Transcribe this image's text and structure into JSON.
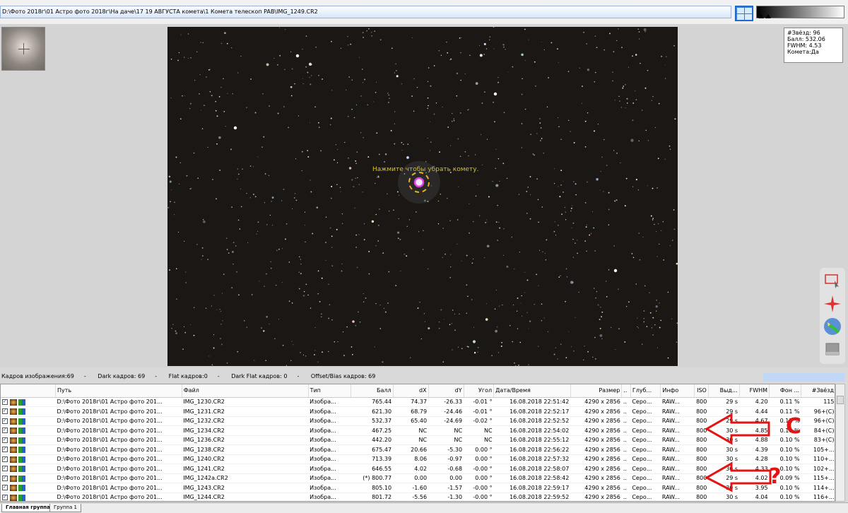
{
  "path": "D:\\Фото 2018г\\01 Астро фото 2018г\\На даче\\17  19 АВГУСТА комета\\1 Комета телескоп PAB\\IMG_1249.CR2",
  "stats": {
    "stars": "#Звёзд: 96",
    "score": "Балл: 532.06",
    "fwhm": "FWHM: 4.53",
    "comet": "Комета:Да"
  },
  "comet_hint": "Нажмите чтобы убрать комету.",
  "counts": {
    "light": "Кадров изображения:69",
    "dark": "Dark кадров: 69",
    "flat": "Flat кадров:0",
    "darkflat": "Dark Flat кадров: 0",
    "bias": "Offset/Bias кадров: 69"
  },
  "columns": [
    "",
    "Путь",
    "Файл",
    "Тип",
    "Балл",
    "dX",
    "dY",
    "Угол",
    "Дата/Время",
    "Размер",
    "..",
    "Глуб...",
    "Инфо",
    "ISO",
    "Выд...",
    "FWHM",
    "Фон ...",
    "#Звёзд"
  ],
  "rows": [
    [
      "D:\\Фото 2018г\\01 Астро фото 201...",
      "IMG_1230.CR2",
      "Изобра...",
      "765.44",
      "74.37",
      "-26.33",
      "-0.01 °",
      "16.08.2018 22:51:42",
      "4290 x 2856",
      "..",
      "Серо...",
      "RAW...",
      "800",
      "29 s",
      "4.20",
      "0.11 %",
      "115"
    ],
    [
      "D:\\Фото 2018г\\01 Астро фото 201...",
      "IMG_1231.CR2",
      "Изобра...",
      "621.30",
      "68.79",
      "-24.46",
      "-0.01 °",
      "16.08.2018 22:52:17",
      "4290 x 2856",
      "..",
      "Серо...",
      "RAW...",
      "800",
      "29 s",
      "4.44",
      "0.11 %",
      "96+(C)"
    ],
    [
      "D:\\Фото 2018г\\01 Астро фото 201...",
      "IMG_1232.CR2",
      "Изобра...",
      "532.37",
      "65.40",
      "-24.69",
      "-0.02 °",
      "16.08.2018 22:52:52",
      "4290 x 2856",
      "..",
      "Серо...",
      "RAW...",
      "800",
      "29 s",
      "4.67",
      "0.11 %",
      "96+(C)"
    ],
    [
      "D:\\Фото 2018г\\01 Астро фото 201...",
      "IMG_1234.CR2",
      "Изобра...",
      "467.25",
      "NC",
      "NC",
      "NC",
      "16.08.2018 22:54:02",
      "4290 x 2856",
      "..",
      "Серо...",
      "RAW...",
      "800",
      "30 s",
      "4.85",
      "0.10 %",
      "84+(C)"
    ],
    [
      "D:\\Фото 2018г\\01 Астро фото 201...",
      "IMG_1236.CR2",
      "Изобра...",
      "442.20",
      "NC",
      "NC",
      "NC",
      "16.08.2018 22:55:12",
      "4290 x 2856",
      "..",
      "Серо...",
      "RAW...",
      "800",
      "30 s",
      "4.88",
      "0.10 %",
      "83+(C)"
    ],
    [
      "D:\\Фото 2018г\\01 Астро фото 201...",
      "IMG_1238.CR2",
      "Изобра...",
      "675.47",
      "20.66",
      "-5.30",
      "0.00 °",
      "16.08.2018 22:56:22",
      "4290 x 2856",
      "..",
      "Серо...",
      "RAW...",
      "800",
      "30 s",
      "4.39",
      "0.10 %",
      "105+..."
    ],
    [
      "D:\\Фото 2018г\\01 Астро фото 201...",
      "IMG_1240.CR2",
      "Изобра...",
      "713.39",
      "8.06",
      "-0.97",
      "0.00 °",
      "16.08.2018 22:57:32",
      "4290 x 2856",
      "..",
      "Серо...",
      "RAW...",
      "800",
      "30 s",
      "4.28",
      "0.10 %",
      "110+..."
    ],
    [
      "D:\\Фото 2018г\\01 Астро фото 201...",
      "IMG_1241.CR2",
      "Изобра...",
      "646.55",
      "4.02",
      "-0.68",
      "-0.00 °",
      "16.08.2018 22:58:07",
      "4290 x 2856",
      "..",
      "Серо...",
      "RAW...",
      "800",
      "30 s",
      "4.33",
      "0.10 %",
      "102+..."
    ],
    [
      "D:\\Фото 2018г\\01 Астро фото 201...",
      "IMG_1242a.CR2",
      "Изобра...",
      "(*) 800.77",
      "0.00",
      "0.00",
      "0.00 °",
      "16.08.2018 22:58:42",
      "4290 x 2856",
      "..",
      "Серо...",
      "RAW...",
      "800",
      "29 s",
      "4.02",
      "0.09 %",
      "115+..."
    ],
    [
      "D:\\Фото 2018г\\01 Астро фото 201...",
      "IMG_1243.CR2",
      "Изобра...",
      "805.10",
      "-1.60",
      "-1.57",
      "-0.00 °",
      "16.08.2018 22:59:17",
      "4290 x 2856",
      "..",
      "Серо...",
      "RAW...",
      "800",
      "30 s",
      "3.95",
      "0.10 %",
      "114+..."
    ],
    [
      "D:\\Фото 2018г\\01 Астро фото 201...",
      "IMG_1244.CR2",
      "Изобра...",
      "801.72",
      "-5.56",
      "-1.30",
      "-0.00 °",
      "16.08.2018 22:59:52",
      "4290 x 2856",
      "..",
      "Серо...",
      "RAW...",
      "800",
      "30 s",
      "4.04",
      "0.10 %",
      "116+..."
    ]
  ],
  "tabs": {
    "main": "Главная группа",
    "group1": "Группа 1"
  },
  "annotations": {
    "c": "C",
    "q": "?"
  },
  "colors": {
    "annotation": "#e41414",
    "comet_hint": "#d8c428",
    "comet_ring": "#e040e0"
  }
}
